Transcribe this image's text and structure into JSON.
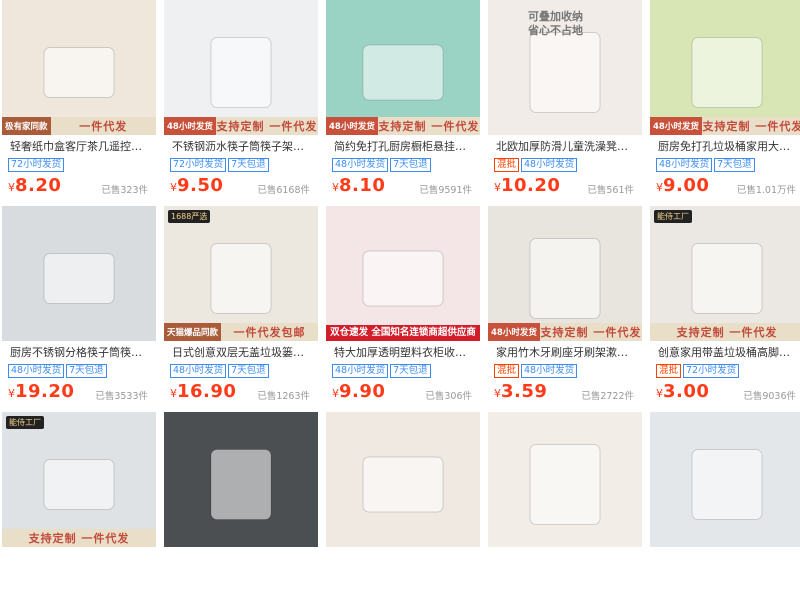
{
  "products": [
    {
      "title": "轻奢纸巾盒客厅茶几遥控器收...",
      "tags": [
        {
          "text": "72小时发货",
          "style": "blue"
        }
      ],
      "price": "8.20",
      "sold": "已售323件",
      "band_left": "",
      "band_right": "一件代发",
      "band_prefix": "极有家同款",
      "bg": "#efe6dc"
    },
    {
      "title": "不锈钢沥水筷子筒筷子架筷笼...",
      "tags": [
        {
          "text": "72小时发货",
          "style": "blue"
        },
        {
          "text": "7天包退",
          "style": "blue"
        }
      ],
      "price": "9.50",
      "sold": "已售6168件",
      "band_left": "48小时发货",
      "band_right": "支持定制 一件代发",
      "band_prefix": "",
      "bg": "#eef0f2"
    },
    {
      "title": "简约免打孔厨房橱柜悬挂垃圾...",
      "tags": [
        {
          "text": "48小时发货",
          "style": "blue"
        },
        {
          "text": "7天包退",
          "style": "blue"
        }
      ],
      "price": "8.10",
      "sold": "已售9591件",
      "band_left": "48小时发货",
      "band_right": "支持定制 一件代发",
      "band_prefix": "",
      "bg": "#9ad3c4"
    },
    {
      "title": "北欧加厚防滑儿童洗澡凳换鞋...",
      "tags": [
        {
          "text": "混批",
          "style": "red"
        },
        {
          "text": "48小时发货",
          "style": "blue"
        }
      ],
      "price": "10.20",
      "sold": "已售561件",
      "band_left": "",
      "band_right": "",
      "band_prefix": "",
      "bg": "#f1ece7",
      "top_text_1": "可叠加收纳",
      "top_text_2": "省心不占地"
    },
    {
      "title": "厨房免打孔垃圾桶家用大号橱...",
      "tags": [
        {
          "text": "48小时发货",
          "style": "blue"
        },
        {
          "text": "7天包退",
          "style": "blue"
        }
      ],
      "price": "9.00",
      "sold": "已售1.01万件",
      "band_left": "48小时发货",
      "band_right": "支持定制 一件代发",
      "band_prefix": "",
      "bg": "#d8e6b6"
    },
    {
      "title": "厨房不锈钢分格筷子筒筷笼多...",
      "tags": [
        {
          "text": "48小时发货",
          "style": "blue"
        },
        {
          "text": "7天包退",
          "style": "blue"
        }
      ],
      "price": "19.20",
      "sold": "已售3533件",
      "band_left": "",
      "band_right": "",
      "band_prefix": "",
      "bg": "#d9dcdf"
    },
    {
      "title": "日式创意双层无盖垃圾篓家用...",
      "tags": [
        {
          "text": "48小时发货",
          "style": "blue"
        },
        {
          "text": "7天包退",
          "style": "blue"
        }
      ],
      "price": "16.90",
      "sold": "已售1263件",
      "band_left": "",
      "band_right": "一件代发包邮",
      "band_prefix": "天猫爆品同款",
      "bg": "#ede8df",
      "badge": "1688严选"
    },
    {
      "title": "特大加厚透明塑料衣柜收纳盒抽...",
      "tags": [
        {
          "text": "48小时发货",
          "style": "blue"
        },
        {
          "text": "7天包退",
          "style": "blue"
        }
      ],
      "price": "9.90",
      "sold": "已售306件",
      "band_left": "",
      "band_right": "",
      "band_prefix": "",
      "bg": "#f4e6e6",
      "banner": "双仓速发 全国知名连锁商超供应商"
    },
    {
      "title": "家用竹木牙刷座牙刷架漱口杯子...",
      "tags": [
        {
          "text": "混批",
          "style": "red"
        },
        {
          "text": "48小时发货",
          "style": "blue"
        }
      ],
      "price": "3.59",
      "sold": "已售2722件",
      "band_left": "48小时发货",
      "band_right": "支持定制 一件代发",
      "band_prefix": "",
      "bg": "#e8e4de"
    },
    {
      "title": "创意家用带盖垃圾桶高脚木纹...",
      "tags": [
        {
          "text": "混批",
          "style": "red"
        },
        {
          "text": "72小时发货",
          "style": "blue"
        }
      ],
      "price": "3.00",
      "sold": "已售9036件",
      "band_left": "",
      "band_right": "支持定制 一件代发",
      "band_prefix": "",
      "bg": "#ebe8e3",
      "badge": "能侍工厂"
    },
    {
      "title": "",
      "tags": [],
      "price": "",
      "sold": "",
      "band_left": "",
      "band_right": "支持定制 一件代发",
      "band_prefix": "",
      "bg": "#dfe2e4",
      "badge": "能侍工厂"
    },
    {
      "title": "",
      "tags": [],
      "price": "",
      "sold": "",
      "band_left": "",
      "band_right": "",
      "band_prefix": "",
      "bg": "#4b4f52"
    },
    {
      "title": "",
      "tags": [],
      "price": "",
      "sold": "",
      "band_left": "",
      "band_right": "",
      "band_prefix": "",
      "bg": "#efe9e2"
    },
    {
      "title": "",
      "tags": [],
      "price": "",
      "sold": "",
      "band_left": "",
      "band_right": "",
      "band_prefix": "",
      "bg": "#f2ede6"
    },
    {
      "title": "",
      "tags": [],
      "price": "",
      "sold": "",
      "band_left": "",
      "band_right": "",
      "band_prefix": "",
      "bg": "#e4e7ea"
    }
  ],
  "currency_symbol": "¥"
}
